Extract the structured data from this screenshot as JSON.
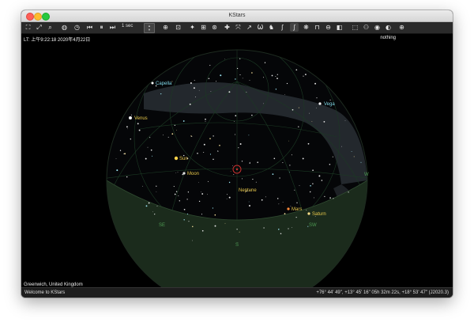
{
  "window": {
    "title": "KStars"
  },
  "toolbar": {
    "buttons": [
      {
        "icon": "fullscreen-icon",
        "glyph": "⛶"
      },
      {
        "icon": "zoom-fit-icon",
        "glyph": "⤢"
      },
      {
        "icon": "find-object-icon",
        "glyph": "⌕"
      },
      {
        "icon": "center-earth-icon",
        "glyph": "●"
      },
      {
        "icon": "set-time-icon",
        "glyph": "◷"
      },
      {
        "icon": "skip-back-icon",
        "glyph": "⏮"
      },
      {
        "icon": "pause-icon",
        "glyph": "⏸"
      },
      {
        "icon": "skip-forward-icon",
        "glyph": "⏭"
      }
    ],
    "speed_label": "1 sec"
  },
  "sky": {
    "local_time": "LT:  上午9:22:18   2020年4月22日",
    "focus_object": "nothing",
    "location": "Greenwich, United Kingdom",
    "labels": {
      "capella": "Capella",
      "venus": "Venus",
      "vega": "Vega",
      "sun": "Sun",
      "moon": "Moon",
      "neptune": "Neptune",
      "mars": "Mars",
      "saturn": "Saturn",
      "se": "SE",
      "sw": "SW",
      "s": "S",
      "w": "W"
    }
  },
  "status": {
    "message": "Welcome to KStars",
    "coordinates": "+76° 44' 49\", +13° 45' 16\"  05h 32m 22s, +18° 53' 47\" (J2020.3)"
  },
  "colors": {
    "planet": "#e8c84a",
    "star_label": "#7fd6e6",
    "horizon_fill": "#1b2b1c"
  }
}
